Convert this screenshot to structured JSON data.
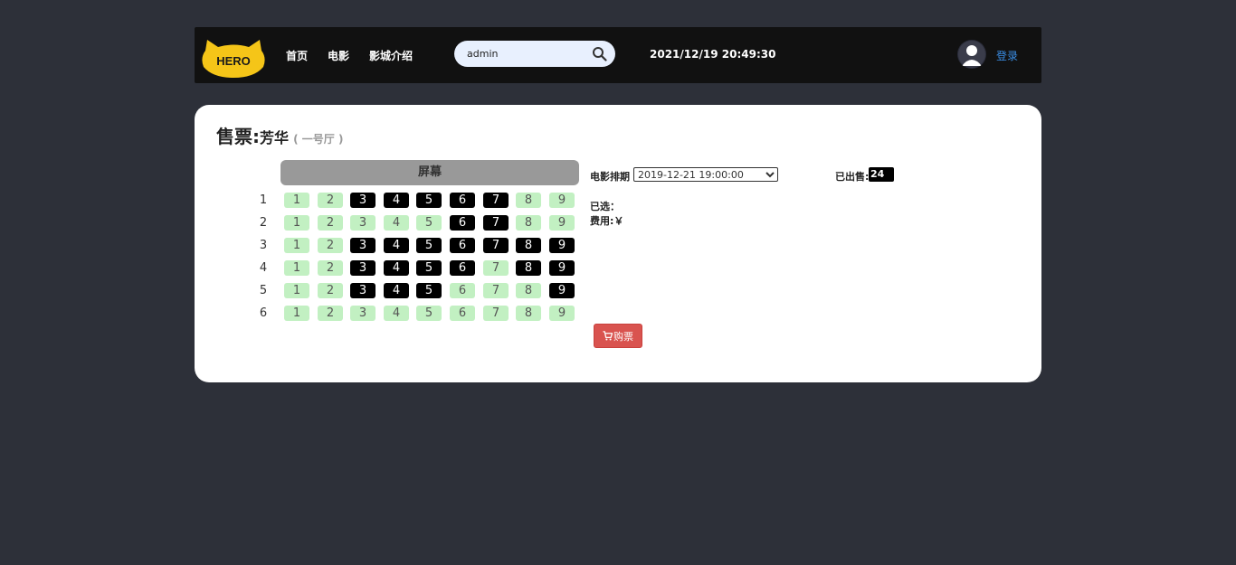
{
  "nav": {
    "logo_text": "HERO",
    "links": [
      "首页",
      "电影",
      "影城介绍"
    ],
    "search": {
      "value": "admin",
      "placeholder": ""
    },
    "datetime": "2021/12/19 20:49:30",
    "login_label": "登录"
  },
  "panel": {
    "title": "售票:",
    "movie": "芳华",
    "hall": "( 一号厅 )",
    "screen_label": "屏幕",
    "schedule_label": "电影排期",
    "schedule_options": [
      "2019-12-21 19:00:00"
    ],
    "sold_label": "已出售:",
    "sold_count": "24",
    "selected_label": "已选：",
    "cost_label": "费用:￥",
    "buy_label": "购票"
  },
  "seats": {
    "rows": [
      "1",
      "2",
      "3",
      "4",
      "5",
      "6"
    ],
    "cols": [
      "1",
      "2",
      "3",
      "4",
      "5",
      "6",
      "7",
      "8",
      "9"
    ],
    "sold": [
      [
        3,
        4,
        5,
        6,
        7
      ],
      [
        6,
        7
      ],
      [
        3,
        4,
        5,
        6,
        7,
        8,
        9
      ],
      [
        3,
        4,
        5,
        6,
        8,
        9
      ],
      [
        3,
        4,
        5,
        9
      ],
      []
    ]
  },
  "colors": {
    "background": "#2d3039",
    "navbar": "#111111",
    "seat_available": "#c2f0c2",
    "seat_sold": "#000000",
    "buy_button": "#d9534f",
    "login_link": "#3a8ee6"
  }
}
